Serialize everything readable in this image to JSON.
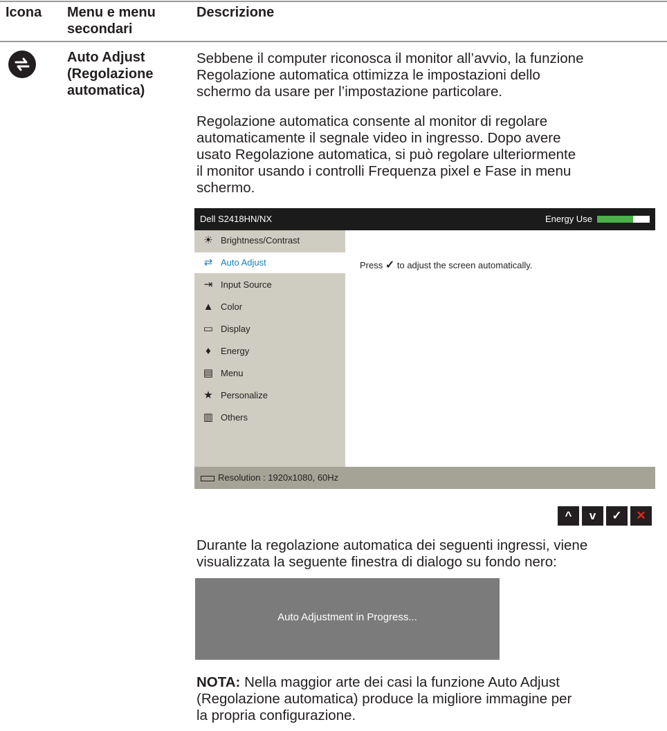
{
  "header": {
    "col_icon": "Icona",
    "col_menu_line1": "Menu e menu",
    "col_menu_line2": "secondari",
    "col_desc": "Descrizione"
  },
  "item": {
    "icon": "auto-adjust-icon",
    "title_line1": "Auto Adjust",
    "title_line2": "(Regolazione",
    "title_line3": "automatica)"
  },
  "description": {
    "p1_line1": "Sebbene il computer riconosca il monitor all’avvio, la funzione",
    "p1_line2": "Regolazione automatica ottimizza le impostazioni dello",
    "p1_line3": "schermo da usare per l’impostazione particolare.",
    "p2_line1": "Regolazione automatica consente al monitor di regolare",
    "p2_line2": "automaticamente il segnale video in ingresso. Dopo avere",
    "p2_line3": "usato Regolazione automatica, si può regolare ulteriormente",
    "p2_line4": "il monitor usando i controlli Frequenza pixel e Fase in menu",
    "p2_line5": "schermo.",
    "p3_line1": "Durante la regolazione automatica dei seguenti ingressi, viene",
    "p3_line2": "visualizzata la seguente finestra di dialogo su fondo nero:",
    "nota_label": "NOTA:",
    "nota_line1": " Nella maggior arte dei casi la funzione Auto Adjust",
    "nota_line2": "(Regolazione automatica) produce la migliore immagine per",
    "nota_line3": "la propria configurazione."
  },
  "osd": {
    "model": "Dell S2418HN/NX",
    "energy_label": "Energy Use",
    "energy_level": 0.68,
    "menu": [
      {
        "label": "Brightness/Contrast",
        "icon": "☀"
      },
      {
        "label": "Auto Adjust",
        "icon": "⇄"
      },
      {
        "label": "Input Source",
        "icon": "⇥"
      },
      {
        "label": "Color",
        "icon": "▲"
      },
      {
        "label": "Display",
        "icon": "▭"
      },
      {
        "label": "Energy",
        "icon": "♦"
      },
      {
        "label": "Menu",
        "icon": "▤"
      },
      {
        "label": "Personalize",
        "icon": "★"
      },
      {
        "label": "Others",
        "icon": "▥"
      }
    ],
    "message_before": "Press ",
    "message_check": "✓",
    "message_after": " to adjust the screen automatically.",
    "resolution": "Resolution : 1920x1080, 60Hz"
  },
  "nav_buttons": {
    "up": "^",
    "down": "v",
    "ok": "✓",
    "close": "✕"
  },
  "dialog": {
    "text": "Auto Adjustment in Progress..."
  },
  "colors": {
    "accent": "#1a7fb5",
    "energy_green": "#4cb04c",
    "close_red": "#e0281f"
  }
}
